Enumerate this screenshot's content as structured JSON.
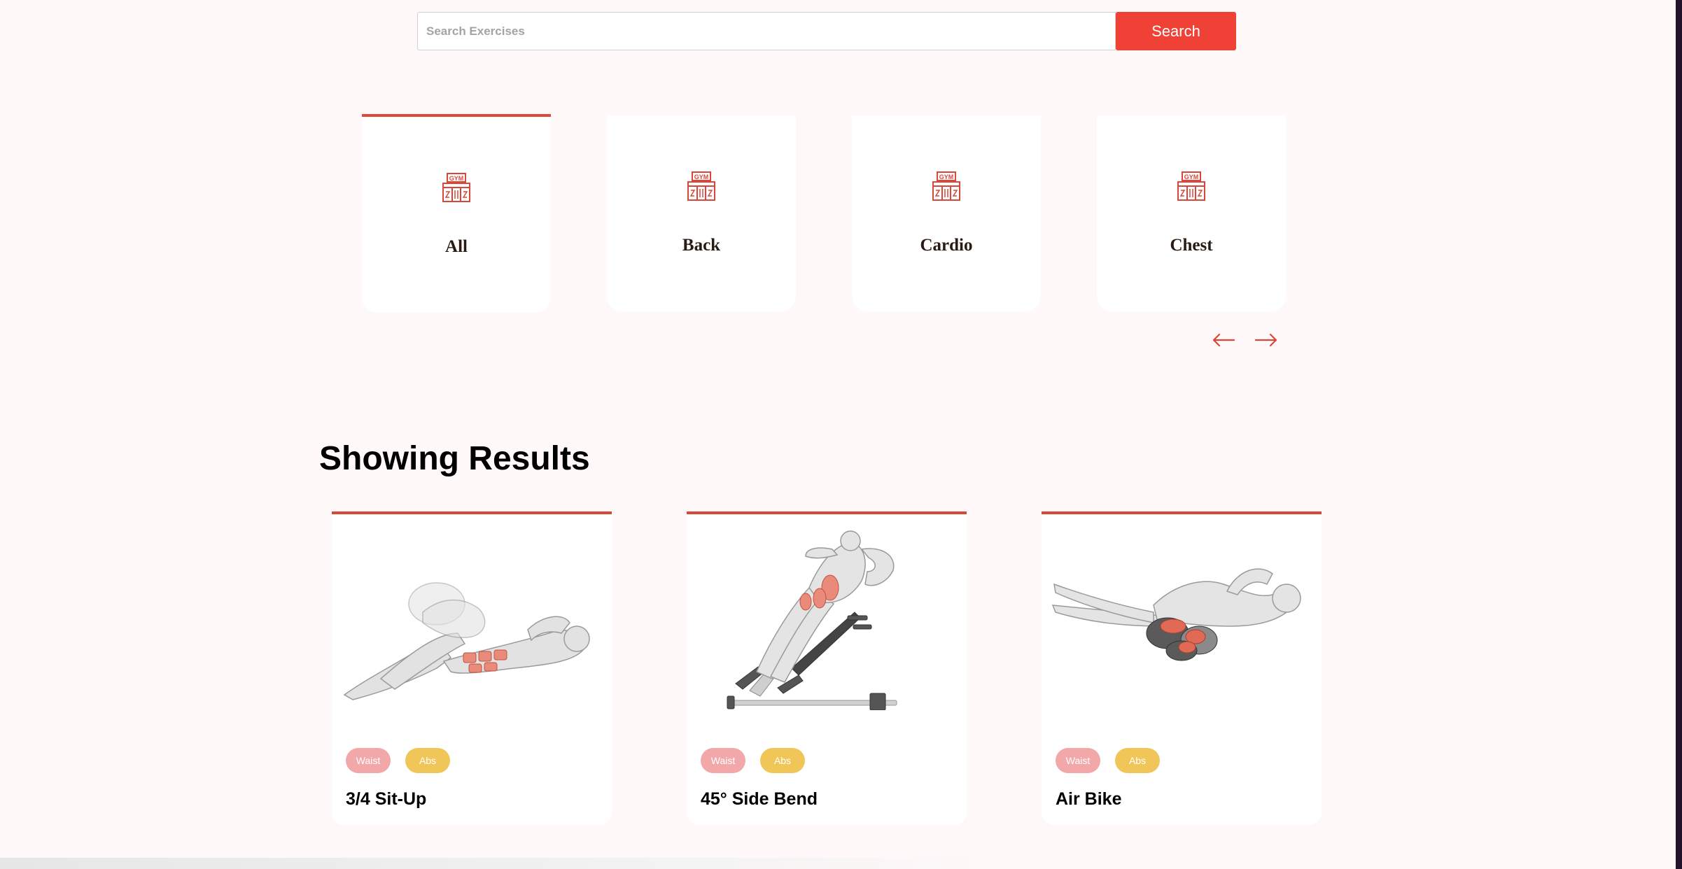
{
  "search": {
    "placeholder": "Search Exercises",
    "button_label": "Search",
    "accent_color": "#ef4136"
  },
  "categories": {
    "items": [
      {
        "label": "All",
        "icon": "gym-icon",
        "selected": true
      },
      {
        "label": "Back",
        "icon": "gym-icon",
        "selected": false
      },
      {
        "label": "Cardio",
        "icon": "gym-icon",
        "selected": false
      },
      {
        "label": "Chest",
        "icon": "gym-icon",
        "selected": false
      }
    ],
    "prev_icon": "arrow-left-icon",
    "next_icon": "arrow-right-icon",
    "icon_text": "GYM"
  },
  "results": {
    "title": "Showing Results",
    "items": [
      {
        "name": "3/4 Sit-Up",
        "body_part": "Waist",
        "target": "Abs",
        "image": "sit-up-illustration"
      },
      {
        "name": "45° Side Bend",
        "body_part": "Waist",
        "target": "Abs",
        "image": "side-bend-illustration"
      },
      {
        "name": "Air Bike",
        "body_part": "Waist",
        "target": "Abs",
        "image": "air-bike-illustration"
      }
    ],
    "tag_colors": {
      "body_part": "#f2a8a8",
      "target": "#f0c659"
    }
  }
}
